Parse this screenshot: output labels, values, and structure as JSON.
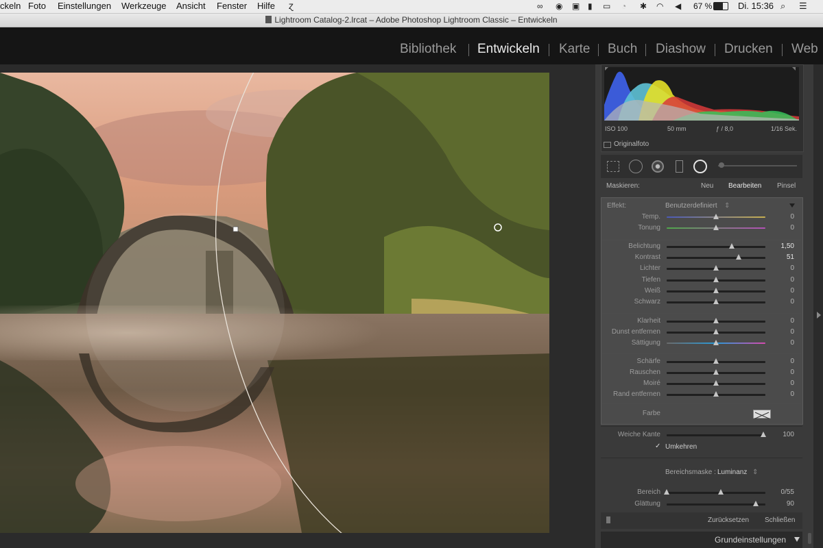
{
  "menubar": {
    "items": [
      "ckeln",
      "Foto",
      "Einstellungen",
      "Werkzeuge",
      "Ansicht",
      "Fenster",
      "Hilfe"
    ],
    "battery": "67 %",
    "clock": "Di. 15:36"
  },
  "window": {
    "title": "Lightroom Catalog-2.lrcat – Adobe Photoshop Lightroom Classic – Entwickeln"
  },
  "modules": [
    "Bibliothek",
    "Entwickeln",
    "Karte",
    "Buch",
    "Diashow",
    "Drucken",
    "Web"
  ],
  "active_module": "Entwickeln",
  "histogram": {
    "iso": "ISO 100",
    "focal": "50 mm",
    "aperture": "ƒ / 8,0",
    "shutter": "1/16 Sek.",
    "original_label": "Originalfoto"
  },
  "mask": {
    "label": "Maskieren:",
    "new": "Neu",
    "edit": "Bearbeiten",
    "brush": "Pinsel",
    "effect_label": "Effekt:",
    "effect_value": "Benutzerdefiniert"
  },
  "sliders": [
    {
      "label": "Temp.",
      "value": "0",
      "pos": 0.5
    },
    {
      "label": "Tonung",
      "value": "0",
      "pos": 0.5
    },
    {
      "label": "Belichtung",
      "value": "1,50",
      "pos": 0.66
    },
    {
      "label": "Kontrast",
      "value": "51",
      "pos": 0.73
    },
    {
      "label": "Lichter",
      "value": "0",
      "pos": 0.5
    },
    {
      "label": "Tiefen",
      "value": "0",
      "pos": 0.5
    },
    {
      "label": "Weiß",
      "value": "0",
      "pos": 0.5
    },
    {
      "label": "Schwarz",
      "value": "0",
      "pos": 0.5
    },
    {
      "label": "Klarheit",
      "value": "0",
      "pos": 0.5
    },
    {
      "label": "Dunst entfernen",
      "value": "0",
      "pos": 0.5
    },
    {
      "label": "Sättigung",
      "value": "0",
      "pos": 0.5
    },
    {
      "label": "Schärfe",
      "value": "0",
      "pos": 0.5
    },
    {
      "label": "Rauschen",
      "value": "0",
      "pos": 0.5
    },
    {
      "label": "Moiré",
      "value": "0",
      "pos": 0.5
    },
    {
      "label": "Rand entfernen",
      "value": "0",
      "pos": 0.5
    }
  ],
  "color_label": "Farbe",
  "feather": {
    "label": "Weiche Kante",
    "value": "100",
    "pos": 0.98
  },
  "invert": {
    "label": "Umkehren",
    "checked": true
  },
  "range_mask": {
    "label": "Bereichsmaske :",
    "value": "Luminanz"
  },
  "range": {
    "label": "Bereich",
    "value": "0/55"
  },
  "smooth": {
    "label": "Glättung",
    "value": "90",
    "pos": 0.9
  },
  "buttons": {
    "reset": "Zurücksetzen",
    "close": "Schließen"
  },
  "basic_panel": "Grundeinstellungen"
}
